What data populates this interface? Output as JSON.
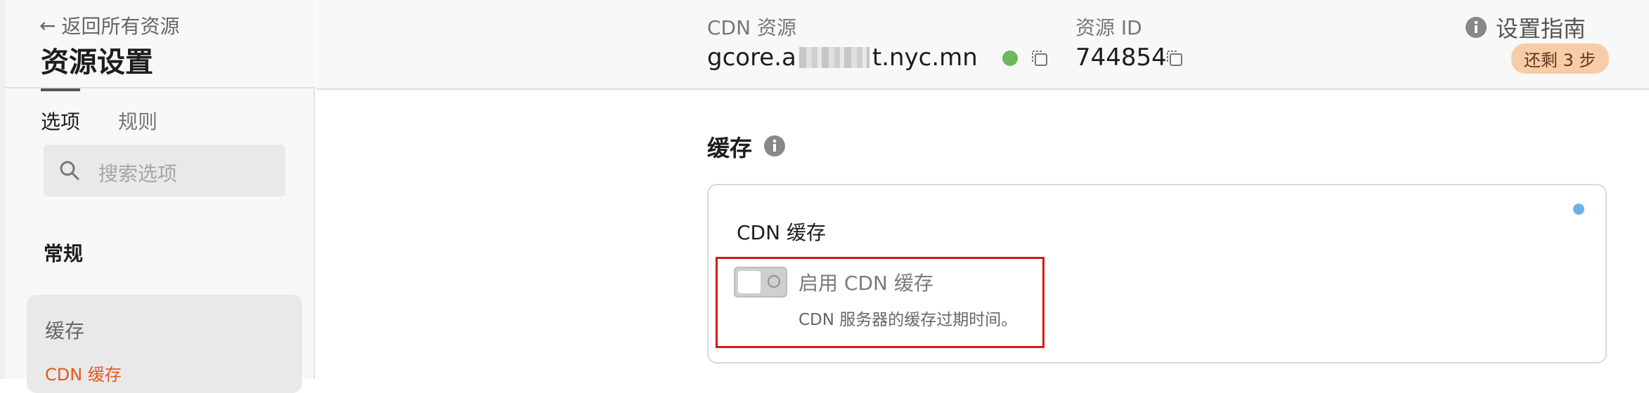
{
  "sidebar": {
    "back_label": "返回所有资源",
    "title": "资源设置",
    "tabs": [
      {
        "label": "选项"
      },
      {
        "label": "规则"
      }
    ],
    "search": {
      "placeholder": "搜索选项"
    },
    "section_general": "常规",
    "cache_section": {
      "title": "缓存",
      "items": [
        {
          "label": "CDN 缓存"
        }
      ]
    }
  },
  "header": {
    "cdn_resource_label": "CDN 资源",
    "cdn_resource_value_prefix": "gcore.a",
    "cdn_resource_value_suffix": "t.nyc.mn",
    "resource_id_label": "资源 ID",
    "resource_id_value": "744854",
    "guide_label": "设置指南",
    "steps_badge": "还剩 3 步"
  },
  "main": {
    "section_title": "缓存",
    "panel": {
      "title": "CDN 缓存",
      "toggle_label": "启用 CDN 缓存",
      "toggle_description": "CDN 服务器的缓存过期时间。",
      "toggle_enabled": false
    }
  },
  "colors": {
    "accent_orange": "#e35a1e",
    "status_green": "#6db85c",
    "highlight_red": "#d01b1b",
    "badge_bg": "#f7cca7",
    "info_dot_blue": "#6ab2e3"
  },
  "icons": [
    "arrow-left-icon",
    "search-icon",
    "copy-icon",
    "info-icon",
    "status-dot-icon",
    "toggle-icon"
  ]
}
